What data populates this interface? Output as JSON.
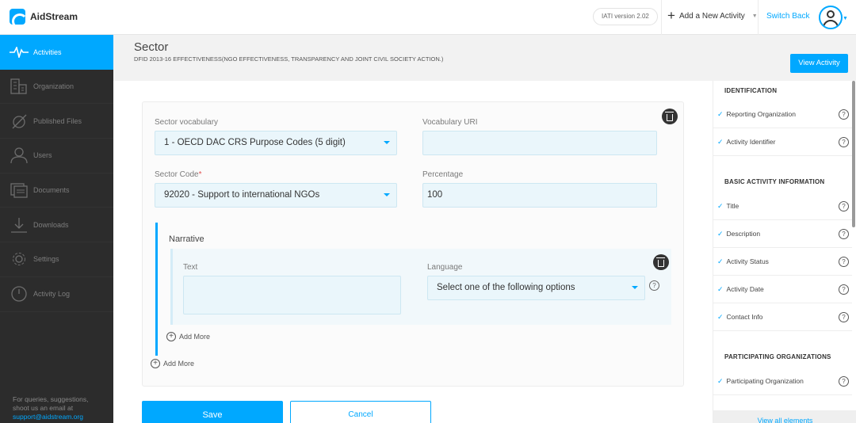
{
  "app": {
    "name": "AidStream"
  },
  "topbar": {
    "iati_version": "IATI version 2.02",
    "add_new_activity": "Add a New Activity",
    "switch_back": "Switch Back"
  },
  "sidebar": {
    "items": [
      {
        "label": "Activities",
        "icon": "pulse-icon",
        "active": true
      },
      {
        "label": "Organization",
        "icon": "building-icon"
      },
      {
        "label": "Published Files",
        "icon": "published-files-icon"
      },
      {
        "label": "Users",
        "icon": "user-icon"
      },
      {
        "label": "Documents",
        "icon": "documents-icon"
      },
      {
        "label": "Downloads",
        "icon": "download-icon"
      },
      {
        "label": "Settings",
        "icon": "gear-icon"
      },
      {
        "label": "Activity Log",
        "icon": "clock-icon"
      }
    ],
    "footer_line1": "For queries, suggestions,",
    "footer_line2": "shoot us an email at",
    "footer_email": "support@aidstream.org"
  },
  "header": {
    "title": "Sector",
    "subtitle": "DFID 2013-16 EFFECTIVENESS(NGO EFFECTIVENESS, TRANSPARENCY AND JOINT CIVIL SOCIETY ACTION.)",
    "view_activity": "View Activity"
  },
  "form": {
    "sector_vocabulary_label": "Sector vocabulary",
    "sector_vocabulary_value": "1 - OECD DAC CRS Purpose Codes (5 digit)",
    "vocabulary_uri_label": "Vocabulary URI",
    "vocabulary_uri_value": "",
    "sector_code_label": "Sector Code",
    "required_mark": "*",
    "sector_code_value": "92020 - Support to international NGOs",
    "percentage_label": "Percentage",
    "percentage_value": "100",
    "narrative": {
      "title": "Narrative",
      "text_label": "Text",
      "text_value": "",
      "language_label": "Language",
      "language_placeholder": "Select one of the following options",
      "help": "?"
    },
    "add_more": "Add More",
    "save": "Save",
    "cancel": "Cancel"
  },
  "right_panel": {
    "sections": [
      {
        "title": "IDENTIFICATION",
        "items": [
          "Reporting Organization",
          "Activity Identifier"
        ]
      },
      {
        "title": "BASIC ACTIVITY INFORMATION",
        "items": [
          "Title",
          "Description",
          "Activity Status",
          "Activity Date",
          "Contact Info"
        ]
      },
      {
        "title": "PARTICIPATING ORGANIZATIONS",
        "items": [
          "Participating Organization"
        ]
      }
    ],
    "check": "✓",
    "help": "?",
    "view_all": "View all elements"
  },
  "colors": {
    "accent": "#00a8ff",
    "sidebar_bg": "#2c2c2c"
  }
}
